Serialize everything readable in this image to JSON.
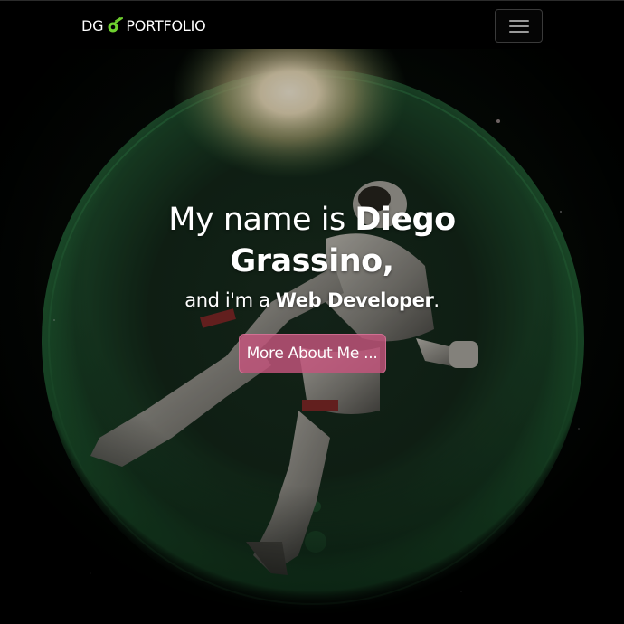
{
  "nav": {
    "brand_left": "DG",
    "brand_right": "PORTFOLIO",
    "brand_icon": "comet-icon",
    "toggle_icon": "hamburger-menu-icon"
  },
  "hero": {
    "headline_prefix": "My name is ",
    "headline_name": "Diego Grassino,",
    "subline_prefix": "and i'm a ",
    "subline_role": "Web Developer",
    "subline_suffix": ".",
    "cta_label": "More About Me ..."
  },
  "colors": {
    "navbar_bg": "#000000",
    "brand_accent": "#6fd12f",
    "cta_bg": "#c4547c",
    "planet_glow": "#2f8a4a"
  }
}
